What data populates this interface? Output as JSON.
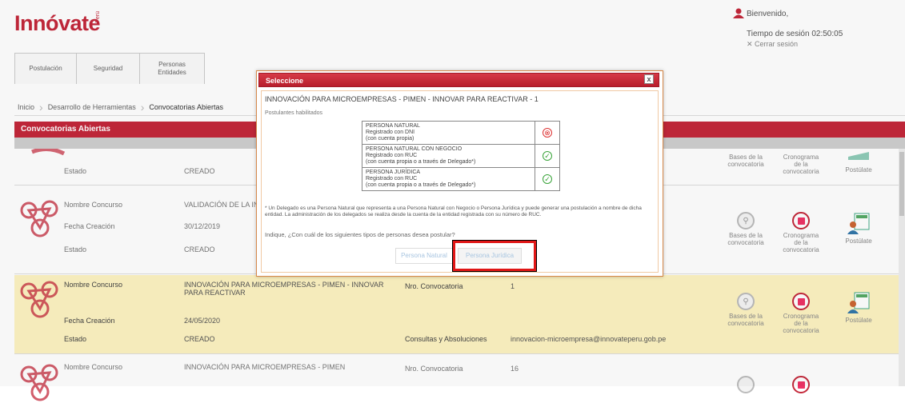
{
  "header": {
    "logo": "Innóvate",
    "logo_sub": "Perú",
    "welcome": "Bienvenido,",
    "session": "Tiempo de sesión 02:50:05",
    "logout": "Cerrar sesión"
  },
  "menu": [
    "Postulación",
    "Seguridad",
    "Personas\nEntidades"
  ],
  "breadcrumb": [
    "Inicio",
    "Desarrollo de Herramientas",
    "Convocatorias Abiertas"
  ],
  "section_title": "Convocatorias Abiertas",
  "rows": [
    {
      "estado_label": "Estado",
      "estado": "CREADO",
      "bases": "Bases de la convocatoria",
      "crono": "Cronograma de la convocatoria",
      "post": "Postúlate"
    },
    {
      "nombre_label": "Nombre Concurso",
      "nombre": "VALIDACIÓN DE LA IN",
      "fecha_label": "Fecha Creación",
      "fecha": "30/12/2019",
      "estado_label": "Estado",
      "estado": "CREADO",
      "bases": "Bases de la convocatoria",
      "crono": "Cronograma de la convocatoria",
      "post": "Postúlate"
    },
    {
      "nombre_label": "Nombre Concurso",
      "nombre": "INNOVACIÓN PARA MICROEMPRESAS - PIMEN - INNOVAR PARA REACTIVAR",
      "nro_label": "Nro. Convocatoria",
      "nro": "1",
      "fecha_label": "Fecha Creación",
      "fecha": "24/05/2020",
      "estado_label": "Estado",
      "estado": "CREADO",
      "consultas_label": "Consultas y Absoluciones",
      "consultas": "innovacion-microempresa@innovateperu.gob.pe",
      "bases": "Bases de la convocatoria",
      "crono": "Cronograma de la convocatoria",
      "post": "Postúlate"
    },
    {
      "nombre_label": "Nombre Concurso",
      "nombre": "INNOVACIÓN PARA MICROEMPRESAS - PIMEN",
      "nro_label": "Nro. Convocatoria",
      "nro": "16"
    }
  ],
  "modal": {
    "title": "Seleccione",
    "close": "x",
    "heading": "INNOVACIÓN PARA MICROEMPRESAS - PIMEN - INNOVAR PARA REACTIVAR - 1",
    "sub": "Postulantes habilitados",
    "types": [
      {
        "line1": "PERSONA NATURAL",
        "line2": "Registrado con DNI",
        "line3": "(con cuenta propia)",
        "status": "⊗"
      },
      {
        "line1": "PERSONA NATURAL CON NEGOCIO",
        "line2": "Registrado con RUC",
        "line3": "(con cuenta propia o a través de Delegado*)",
        "status": "✓"
      },
      {
        "line1": "PERSONA JURÍDICA",
        "line2": "Registrado con RUC",
        "line3": "(con cuenta propia o a través de Delegado*)",
        "status": "✓"
      }
    ],
    "note": "* Un Delegado es una Persona Natural que representa a una Persona Natural con Negocio o Persona Jurídica y puede generar una postulación a nombre de dicha entidad. La administración de los delegados se realiza desde la cuenta de la entidad registrada con su número de RUC.",
    "question": "Indique, ¿Con cuál de los siguientes tipos de personas desea postular?",
    "btn_natural": "Persona Natural",
    "btn_juridica": "Persona Jurídica"
  }
}
